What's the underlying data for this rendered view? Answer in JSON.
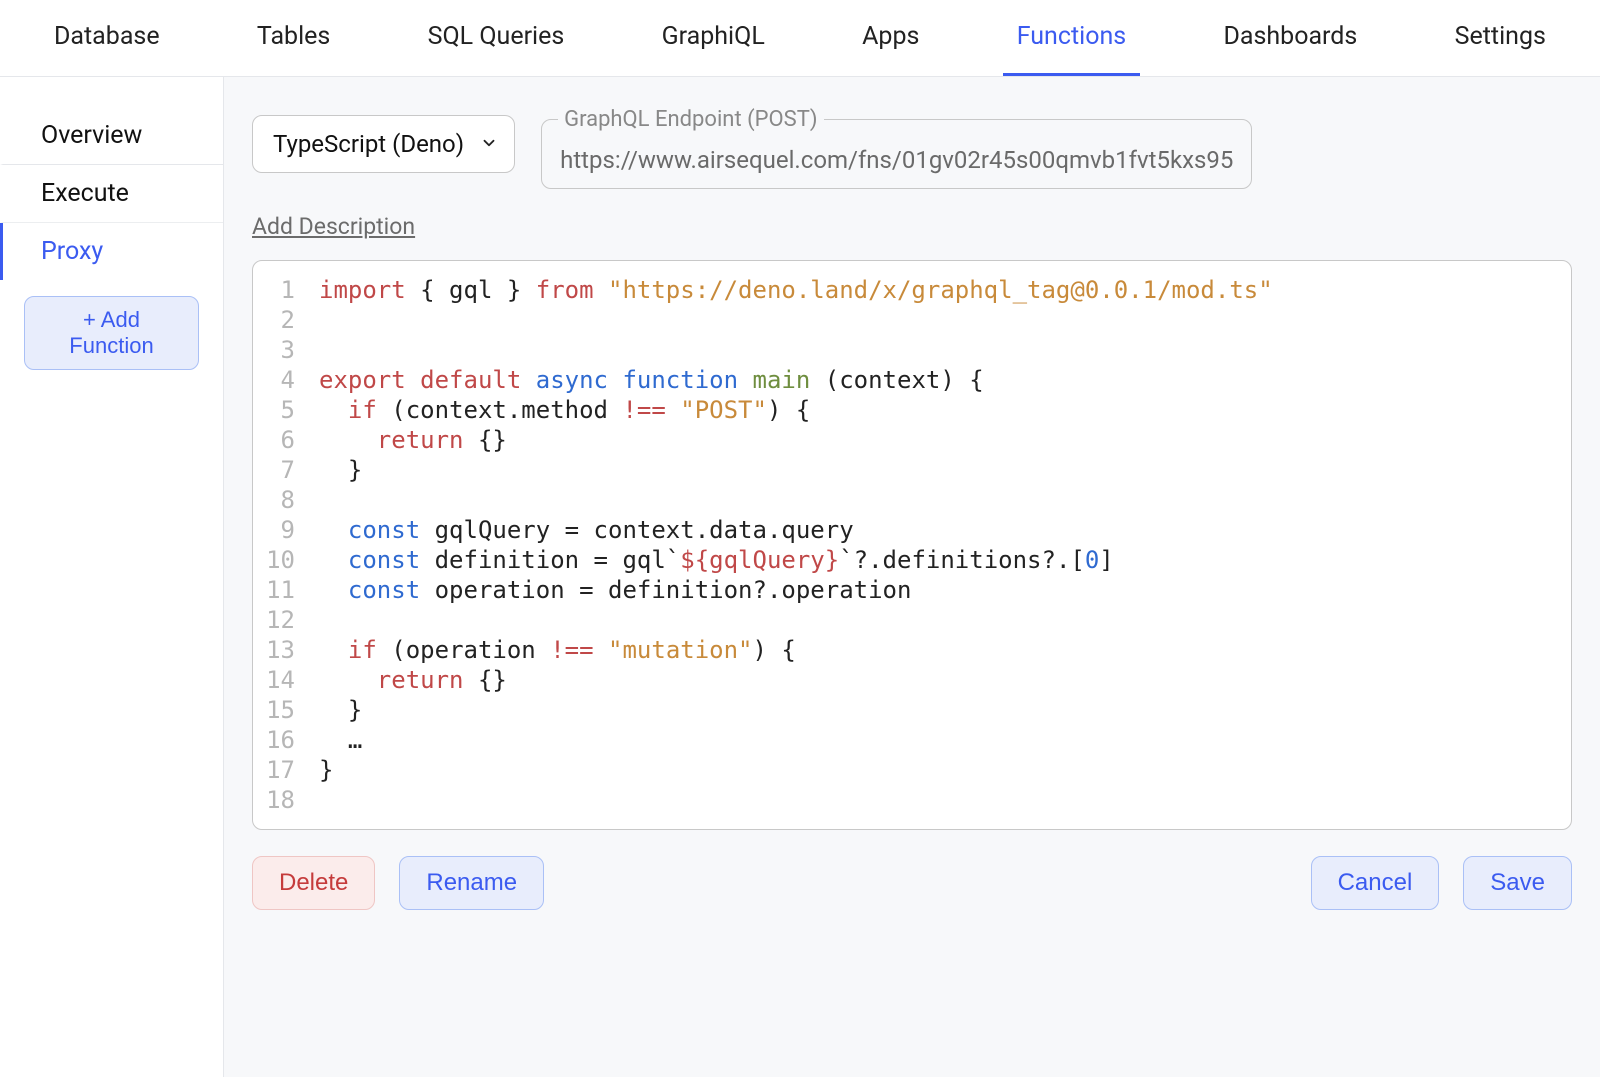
{
  "nav": {
    "items": [
      {
        "label": "Database"
      },
      {
        "label": "Tables"
      },
      {
        "label": "SQL Queries"
      },
      {
        "label": "GraphiQL"
      },
      {
        "label": "Apps"
      },
      {
        "label": "Functions"
      },
      {
        "label": "Dashboards"
      },
      {
        "label": "Settings"
      }
    ],
    "active_index": 5
  },
  "sidebar": {
    "items": [
      {
        "label": "Overview"
      },
      {
        "label": "Execute"
      },
      {
        "label": "Proxy"
      }
    ],
    "active_index": 2,
    "add_function_label": "+ Add Function"
  },
  "controls": {
    "language_selected": "TypeScript (Deno)",
    "endpoint_legend": "GraphQL Endpoint (POST)",
    "endpoint_value": "https://www.airsequel.com/fns/01gv02r45s00qmvb1fvt5kxs95",
    "add_description_label": "Add Description"
  },
  "code": {
    "lines": [
      {
        "n": "1",
        "tokens": [
          {
            "t": "import ",
            "c": "tk-kw"
          },
          {
            "t": "{ gql } ",
            "c": "tk-text"
          },
          {
            "t": "from ",
            "c": "tk-kw"
          },
          {
            "t": "\"https://deno.land/x/graphql_tag@0.0.1/mod.ts\"",
            "c": "tk-str"
          }
        ]
      },
      {
        "n": "2",
        "tokens": []
      },
      {
        "n": "3",
        "tokens": []
      },
      {
        "n": "4",
        "tokens": [
          {
            "t": "export ",
            "c": "tk-kw"
          },
          {
            "t": "default ",
            "c": "tk-kw"
          },
          {
            "t": "async ",
            "c": "tk-kw2"
          },
          {
            "t": "function ",
            "c": "tk-kw2"
          },
          {
            "t": "main ",
            "c": "tk-fn"
          },
          {
            "t": "(context) {",
            "c": "tk-text"
          }
        ]
      },
      {
        "n": "5",
        "tokens": [
          {
            "t": "  ",
            "c": "tk-text"
          },
          {
            "t": "if ",
            "c": "tk-kw"
          },
          {
            "t": "(context.method ",
            "c": "tk-text"
          },
          {
            "t": "!== ",
            "c": "tk-op"
          },
          {
            "t": "\"POST\"",
            "c": "tk-str"
          },
          {
            "t": ") {",
            "c": "tk-text"
          }
        ]
      },
      {
        "n": "6",
        "tokens": [
          {
            "t": "    ",
            "c": "tk-text"
          },
          {
            "t": "return ",
            "c": "tk-kw"
          },
          {
            "t": "{}",
            "c": "tk-text"
          }
        ]
      },
      {
        "n": "7",
        "tokens": [
          {
            "t": "  }",
            "c": "tk-text"
          }
        ]
      },
      {
        "n": "8",
        "tokens": []
      },
      {
        "n": "9",
        "tokens": [
          {
            "t": "  ",
            "c": "tk-text"
          },
          {
            "t": "const ",
            "c": "tk-kw3"
          },
          {
            "t": "gqlQuery = context.data.query",
            "c": "tk-text"
          }
        ]
      },
      {
        "n": "10",
        "tokens": [
          {
            "t": "  ",
            "c": "tk-text"
          },
          {
            "t": "const ",
            "c": "tk-kw3"
          },
          {
            "t": "definition = gql`",
            "c": "tk-text"
          },
          {
            "t": "${gqlQuery}",
            "c": "tk-tpl"
          },
          {
            "t": "`?.definitions?.[",
            "c": "tk-text"
          },
          {
            "t": "0",
            "c": "tk-num"
          },
          {
            "t": "]",
            "c": "tk-text"
          }
        ]
      },
      {
        "n": "11",
        "tokens": [
          {
            "t": "  ",
            "c": "tk-text"
          },
          {
            "t": "const ",
            "c": "tk-kw3"
          },
          {
            "t": "operation = definition?.operation",
            "c": "tk-text"
          }
        ]
      },
      {
        "n": "12",
        "tokens": []
      },
      {
        "n": "13",
        "tokens": [
          {
            "t": "  ",
            "c": "tk-text"
          },
          {
            "t": "if ",
            "c": "tk-kw"
          },
          {
            "t": "(operation ",
            "c": "tk-text"
          },
          {
            "t": "!== ",
            "c": "tk-op"
          },
          {
            "t": "\"mutation\"",
            "c": "tk-str"
          },
          {
            "t": ") {",
            "c": "tk-text"
          }
        ]
      },
      {
        "n": "14",
        "tokens": [
          {
            "t": "    ",
            "c": "tk-text"
          },
          {
            "t": "return ",
            "c": "tk-kw"
          },
          {
            "t": "{}",
            "c": "tk-text"
          }
        ]
      },
      {
        "n": "15",
        "tokens": [
          {
            "t": "  }",
            "c": "tk-text"
          }
        ]
      },
      {
        "n": "16",
        "tokens": [
          {
            "t": "  …",
            "c": "tk-text"
          }
        ]
      },
      {
        "n": "17",
        "tokens": [
          {
            "t": "}",
            "c": "tk-text"
          }
        ]
      },
      {
        "n": "18",
        "tokens": []
      }
    ]
  },
  "actions": {
    "delete_label": "Delete",
    "rename_label": "Rename",
    "cancel_label": "Cancel",
    "save_label": "Save"
  }
}
